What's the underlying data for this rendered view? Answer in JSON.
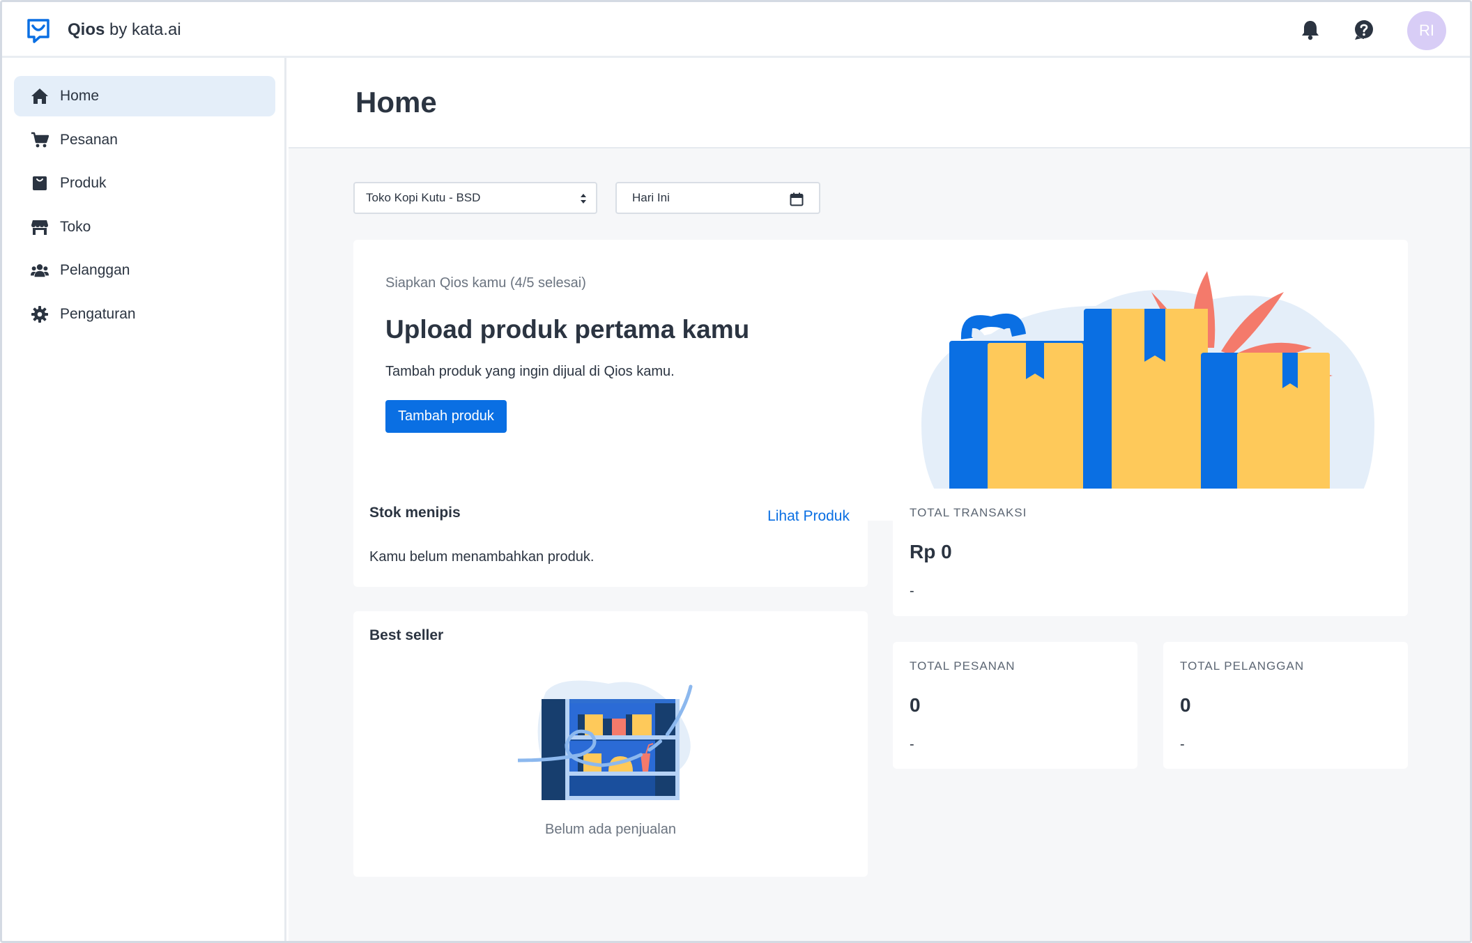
{
  "app": {
    "brand_name": "Qios",
    "brand_suffix": " by kata.ai",
    "avatar_initials": "RI",
    "accent_color": "#0a6fe3"
  },
  "header_icons": [
    "bell-icon",
    "help-icon"
  ],
  "sidebar": {
    "items": [
      {
        "label": "Home",
        "icon": "home-icon",
        "active": true
      },
      {
        "label": "Pesanan",
        "icon": "cart-icon",
        "active": false
      },
      {
        "label": "Produk",
        "icon": "product-bag-icon",
        "active": false
      },
      {
        "label": "Toko",
        "icon": "store-icon",
        "active": false
      },
      {
        "label": "Pelanggan",
        "icon": "users-icon",
        "active": false
      },
      {
        "label": "Pengaturan",
        "icon": "gear-icon",
        "active": false
      }
    ]
  },
  "page": {
    "title": "Home"
  },
  "filters": {
    "store_select": "Toko Kopi Kutu - BSD",
    "date_range": "Hari Ini"
  },
  "setup": {
    "progress": "Siapkan Qios kamu (4/5 selesai)",
    "title": "Upload produk pertama kamu",
    "description": "Tambah produk yang ingin dijual di Qios kamu.",
    "button": "Tambah produk"
  },
  "stok": {
    "title": "Stok menipis",
    "link": "Lihat Produk",
    "empty": "Kamu belum menambahkan produk."
  },
  "best_seller": {
    "title": "Best seller",
    "empty": "Belum ada penjualan"
  },
  "stats": {
    "transaksi": {
      "label": "TOTAL TRANSAKSI",
      "value": "Rp 0",
      "sub": "-"
    },
    "pesanan": {
      "label": "TOTAL PESANAN",
      "value": "0",
      "sub": "-"
    },
    "pelanggan": {
      "label": "TOTAL PELANGGAN",
      "value": "0",
      "sub": "-"
    }
  }
}
